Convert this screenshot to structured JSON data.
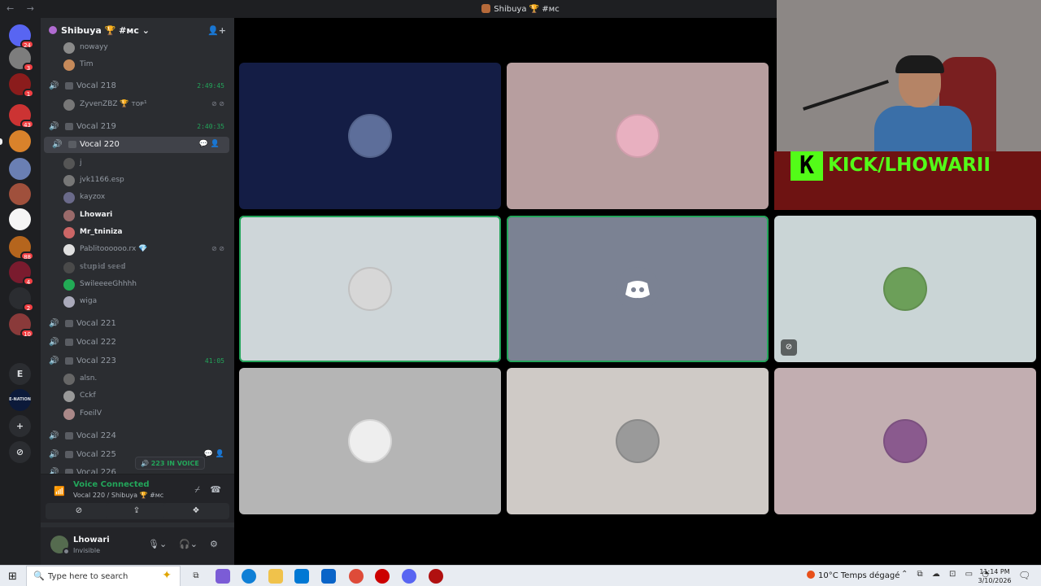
{
  "window": {
    "title": "Shibuya 🏆 #мс",
    "nav": "← →"
  },
  "server": {
    "name": "Shibuya 🏆 #мс ⌄",
    "invite_icon": "👤+"
  },
  "rail": [
    {
      "name": "dm-home",
      "badge": "24",
      "color": "#5865f2"
    },
    {
      "name": "server-1",
      "badge": "3",
      "color": "#7d7d7d"
    },
    {
      "name": "server-2",
      "badge": "1",
      "color": "#8b1c1c"
    },
    {
      "name": "server-3",
      "badge": "43",
      "color": "#c33"
    },
    {
      "name": "server-4",
      "badge": "",
      "color": "#d9822b"
    },
    {
      "name": "server-5",
      "badge": "",
      "color": "#6a7fb3"
    },
    {
      "name": "server-6",
      "badge": "",
      "color": "#a0503c"
    },
    {
      "name": "server-7",
      "badge": "",
      "color": "#f5f5f5"
    },
    {
      "name": "server-8",
      "badge": "88",
      "color": "#b5651d"
    },
    {
      "name": "server-9",
      "badge": "4",
      "color": "#7a1b2e"
    },
    {
      "name": "server-10",
      "badge": "2",
      "color": "#2b2d31"
    },
    {
      "name": "server-11",
      "badge": "10",
      "color": "#8a3a3a"
    }
  ],
  "rail_text": {
    "e": "E",
    "enation": "E-NATION",
    "add": "+",
    "explore": "⊘"
  },
  "channels": [
    {
      "type": "user",
      "name": "nowayy",
      "bright": false
    },
    {
      "type": "user",
      "name": "Tim",
      "bright": false
    },
    {
      "type": "channel",
      "name": "Vocal 218",
      "time": "2:49:45",
      "active": true
    },
    {
      "type": "user",
      "name": "ZyvenZBZ 🏆 ᴛᴏᴘ¹",
      "bright": false,
      "icons": "⊘ ⊘"
    },
    {
      "type": "channel",
      "name": "Vocal 219",
      "time": "2:40:35",
      "active": true
    },
    {
      "type": "channel",
      "name": "Vocal 220",
      "selected": true,
      "active": true,
      "icons": "💬 👤"
    },
    {
      "type": "user",
      "name": "j",
      "bright": false
    },
    {
      "type": "user",
      "name": "jvk1166.esp",
      "bright": false
    },
    {
      "type": "user",
      "name": "kayzox",
      "bright": false
    },
    {
      "type": "user",
      "name": "Lhowari",
      "bright": true
    },
    {
      "type": "user",
      "name": "Mr_tniniza",
      "bright": true
    },
    {
      "type": "user",
      "name": "Pablitoooooo.rx 💎",
      "bright": false,
      "icons": "⊘ ⊘"
    },
    {
      "type": "user",
      "name": "𝕤𝕥𝕦𝕡𝕚𝕕 𝕤𝕖𝕖𝕕",
      "bright": false
    },
    {
      "type": "user",
      "name": "SwileeeeGhhhh",
      "bright": false
    },
    {
      "type": "user",
      "name": "wiga",
      "bright": false
    },
    {
      "type": "channel",
      "name": "Vocal 221",
      "active": false
    },
    {
      "type": "channel",
      "name": "Vocal 222",
      "active": false
    },
    {
      "type": "channel",
      "name": "Vocal 223",
      "time": "41:05",
      "active": true
    },
    {
      "type": "user",
      "name": "alsn.",
      "bright": false
    },
    {
      "type": "user",
      "name": "Cckf",
      "bright": false
    },
    {
      "type": "user",
      "name": "FoeilV",
      "bright": false
    },
    {
      "type": "channel",
      "name": "Vocal 224",
      "active": false
    },
    {
      "type": "channel",
      "name": "Vocal 225",
      "active": false,
      "icons": "💬 👤"
    },
    {
      "type": "channel",
      "name": "Vocal 226",
      "active": false
    }
  ],
  "tooltip": "🔊 223 IN VOICE",
  "voice": {
    "status": "Voice Connected",
    "location": "Vocal 220 / Shibuya 🏆 #мс",
    "buttons": [
      "⊘",
      "⇪",
      "❖"
    ]
  },
  "account": {
    "name": "Lhowari",
    "status": "Invisible"
  },
  "tiles": [
    {
      "name": "tile-1",
      "bg": "#141d45",
      "avatar": "#5d6e9a",
      "speaking": false,
      "muted": false
    },
    {
      "name": "tile-2",
      "bg": "#b79e9f",
      "avatar": "#e8b0c0",
      "speaking": false,
      "muted": false
    },
    {
      "name": "tile-4",
      "bg": "#ced6d9",
      "avatar": "#d7d7d7",
      "speaking": true,
      "muted": false
    },
    {
      "name": "tile-5",
      "bg": "#7b8293",
      "avatar": "#7b8293",
      "speaking": true,
      "muted": false
    },
    {
      "name": "tile-6",
      "bg": "#cad5d6",
      "avatar": "#6c9f59",
      "speaking": false,
      "muted": true
    },
    {
      "name": "tile-7",
      "bg": "#b5b5b5",
      "avatar": "#eeeeee",
      "speaking": false,
      "muted": false
    },
    {
      "name": "tile-8",
      "bg": "#cfcac6",
      "avatar": "#9a9a9a",
      "speaking": false,
      "muted": false
    },
    {
      "name": "tile-9",
      "bg": "#c2aeb1",
      "avatar": "#8a5a8e",
      "speaking": false,
      "muted": false
    }
  ],
  "overlay": {
    "kick_logo": "K",
    "kick_text": "KICK/LHOWARII"
  },
  "taskbar": {
    "search_placeholder": "Type here to search",
    "weather": "10°C  Temps dégagé",
    "tray": "⌃ ⧉ ☁ ⊡ ▭ ◔",
    "time": "11:14 PM",
    "date": "3/10/2026"
  },
  "colors": {
    "accent_green": "#23a55a",
    "kick_green": "#53fc18",
    "blurple": "#5865f2"
  }
}
